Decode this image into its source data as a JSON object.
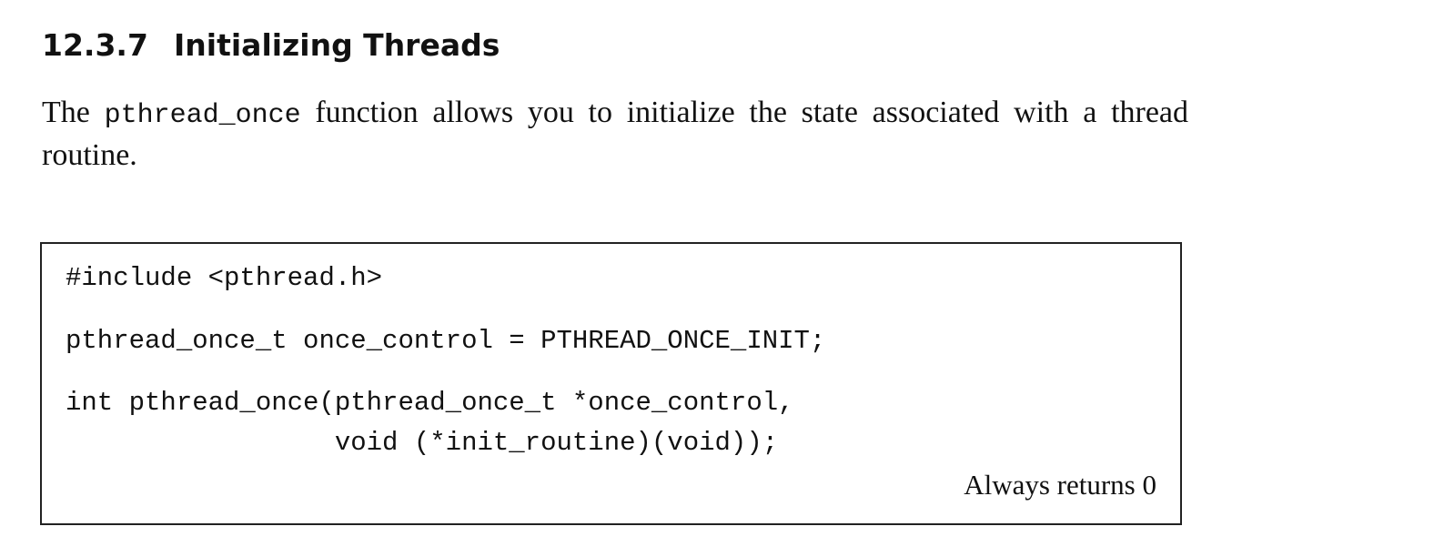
{
  "section": {
    "number": "12.3.7",
    "title": "Initializing Threads"
  },
  "intro": {
    "lead": "The",
    "function_name": "pthread_once",
    "rest_line1": "function allows you to initialize the state associated with a",
    "rest_line2": "thread routine."
  },
  "prototype_box": {
    "code_lines": [
      "#include <pthread.h>",
      "pthread_once_t once_control = PTHREAD_ONCE_INIT;",
      "int pthread_once(pthread_once_t *once_control,",
      "                 void (*init_routine)(void));"
    ],
    "returns_note": "Always returns 0"
  }
}
